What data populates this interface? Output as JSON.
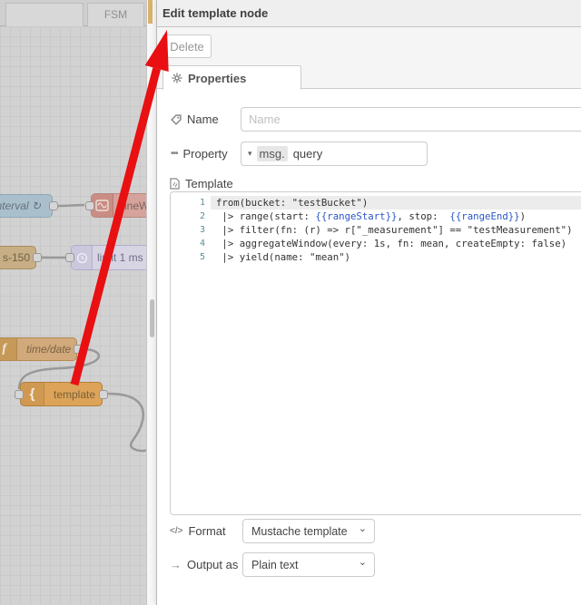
{
  "colors": {
    "arrow_red": "#e81012",
    "template_node_orange": "#dda358",
    "mustache_var_blue": "#2a56c6",
    "wire_gray": "#999999",
    "panel_header_bg": "#efefef"
  },
  "canvas": {
    "tabs": [
      {
        "label": ""
      },
      {
        "label": "FSM"
      }
    ],
    "nodes": {
      "interval": {
        "label": "interval ↻"
      },
      "sinewave": {
        "label": "sineW"
      },
      "s150": {
        "label": "s-150"
      },
      "limit": {
        "label": "limit 1 ms"
      },
      "timedate": {
        "label": "time/date",
        "icon_letter": "f"
      },
      "template": {
        "label": "template",
        "icon_glyph": "{"
      }
    }
  },
  "panel": {
    "title": "Edit template node",
    "toolbar": {
      "delete_label": "Delete"
    },
    "tabs": [
      {
        "label": "Properties"
      }
    ],
    "fields": {
      "name": {
        "label": "Name",
        "placeholder": "Name",
        "value": ""
      },
      "property": {
        "label": "Property",
        "caret": "▾",
        "prefix": "msg.",
        "value": "query"
      },
      "template": {
        "label": "Template"
      },
      "format": {
        "label": "Format",
        "icon": "</>",
        "value": "Mustache template",
        "chevron": "⌄"
      },
      "output": {
        "label": "Output as",
        "icon": "→",
        "value": "Plain text",
        "chevron": "⌄"
      }
    },
    "editor": {
      "lines": [
        {
          "num": "1",
          "active": true,
          "segments": [
            {
              "text": "from(bucket: \"testBucket\")",
              "type": "code"
            }
          ]
        },
        {
          "num": "2",
          "active": false,
          "segments": [
            {
              "text": " |> range(start: ",
              "type": "code"
            },
            {
              "text": "{{rangeStart}}",
              "type": "var"
            },
            {
              "text": ", stop:  ",
              "type": "code"
            },
            {
              "text": "{{rangeEnd}}",
              "type": "var"
            },
            {
              "text": ")",
              "type": "code"
            }
          ]
        },
        {
          "num": "3",
          "active": false,
          "segments": [
            {
              "text": " |> filter(fn: (r) => r[\"_measurement\"] == \"testMeasurement\")",
              "type": "code"
            }
          ]
        },
        {
          "num": "4",
          "active": false,
          "segments": [
            {
              "text": " |> aggregateWindow(every: 1s, fn: mean, createEmpty: false)",
              "type": "code"
            }
          ]
        },
        {
          "num": "5",
          "active": false,
          "segments": [
            {
              "text": " |> yield(name: \"mean\")",
              "type": "code"
            }
          ]
        }
      ]
    }
  }
}
